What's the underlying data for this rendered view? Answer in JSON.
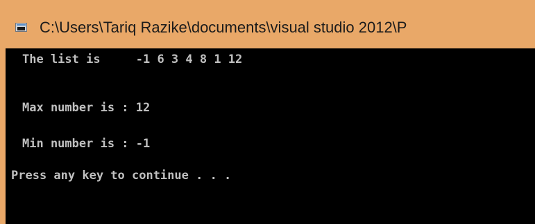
{
  "window": {
    "title": "C:\\Users\\Tariq Razike\\documents\\visual studio 2012\\P",
    "icon": "console-window-icon"
  },
  "console": {
    "lines": [
      "The list is     -1 6 3 4 8 1 12",
      "Max number is : 12",
      "Min number is : -1",
      "Press any key to continue . . ."
    ]
  },
  "colors": {
    "title_bar": "#e9a868",
    "console_bg": "#000000",
    "console_text": "#c0c0c0"
  }
}
